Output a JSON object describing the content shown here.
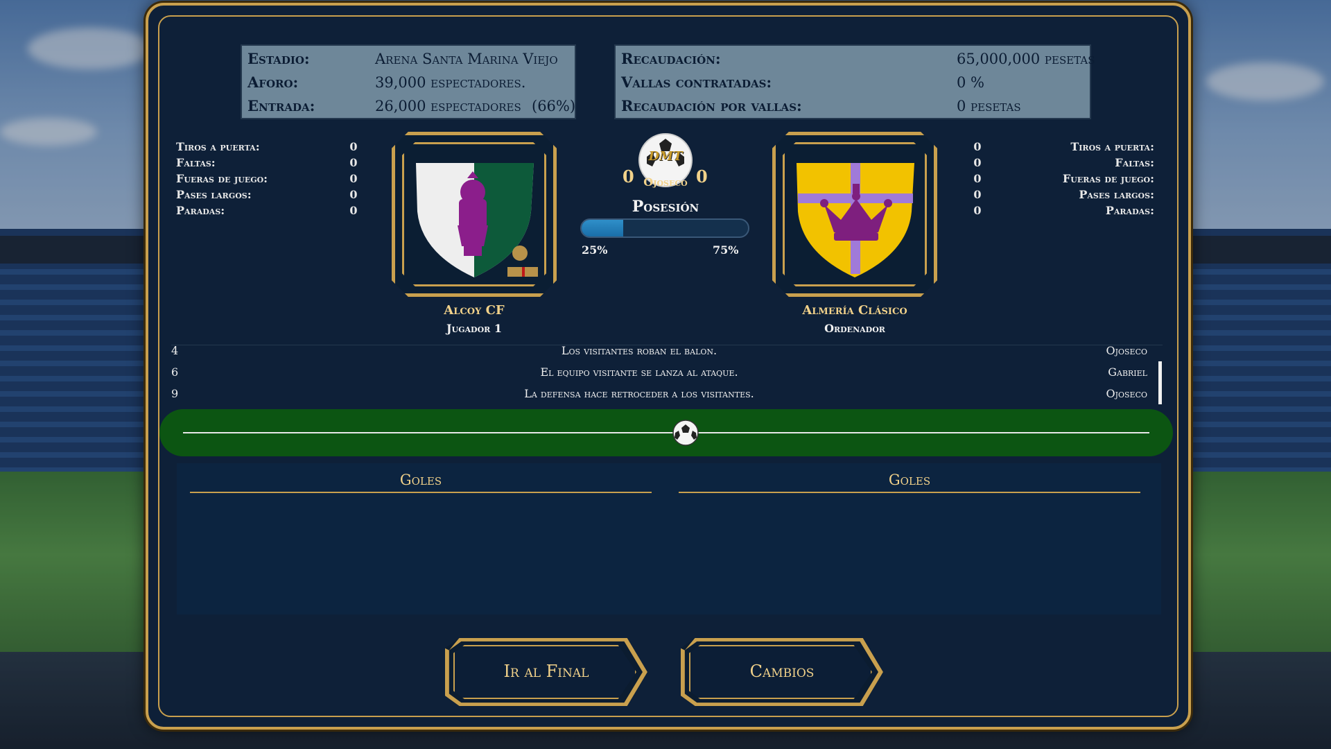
{
  "stadium_info": {
    "stadium_label": "Estadio:",
    "stadium_value": "Arena Santa Marina Viejo",
    "capacity_label": "Aforo:",
    "capacity_value": "39,000 espectadores.",
    "attendance_label": "Entrada:",
    "attendance_value": "26,000 espectadores",
    "attendance_pct": "(66%)"
  },
  "revenue_info": {
    "revenue_label": "Recaudación:",
    "revenue_value": "65,000,000 pesetas",
    "ads_label": "Vallas contratadas:",
    "ads_value": "0 %",
    "ads_revenue_label": "Recaudación por vallas:",
    "ads_revenue_value": "0 pesetas"
  },
  "home_stats": [
    {
      "label": "Tiros a puerta:",
      "value": "0"
    },
    {
      "label": "Faltas:",
      "value": "0"
    },
    {
      "label": "Fueras de juego:",
      "value": "0"
    },
    {
      "label": "Pases largos:",
      "value": "0"
    },
    {
      "label": "Paradas:",
      "value": "0"
    }
  ],
  "away_stats": [
    {
      "label": "Tiros a puerta:",
      "value": "0"
    },
    {
      "label": "Faltas:",
      "value": "0"
    },
    {
      "label": "Fueras de juego:",
      "value": "0"
    },
    {
      "label": "Pases largos:",
      "value": "0"
    },
    {
      "label": "Paradas:",
      "value": "0"
    }
  ],
  "home_team": {
    "name": "Alcoy CF",
    "controller": "Jugador 1",
    "crest_colors": [
      "#eeeeee",
      "#0d5a3a",
      "#8b1e8b"
    ]
  },
  "away_team": {
    "name": "Almería Clásico",
    "controller": "Ordenador",
    "crest_colors": [
      "#f2c200",
      "#a07ad8",
      "#7e1f7e"
    ]
  },
  "match": {
    "home_score": "0",
    "away_score": "0",
    "referee": "Ojoseco",
    "logo_text": "DMT",
    "possession_title": "Posesión",
    "home_possession": 0.25,
    "home_possession_label": "25%",
    "away_possession_label": "75%",
    "ball_position": 0.52
  },
  "commentary": [
    {
      "minute": "4",
      "text": "Los visitantes roban el balon.",
      "player": "Ojoseco"
    },
    {
      "minute": "6",
      "text": "El equipo visitante se lanza al ataque.",
      "player": "Gabriel"
    },
    {
      "minute": "9",
      "text": "La defensa hace retroceder a los visitantes.",
      "player": "Ojoseco"
    }
  ],
  "goals": {
    "home_title": "Goles",
    "away_title": "Goles"
  },
  "buttons": {
    "skip_label": "Ir al Final",
    "subs_label": "Cambios"
  },
  "colors": {
    "gold": "#c9a04e",
    "panel": "#0e2038",
    "field": "#0c5512",
    "possession_fill": "#2f8fc9"
  }
}
